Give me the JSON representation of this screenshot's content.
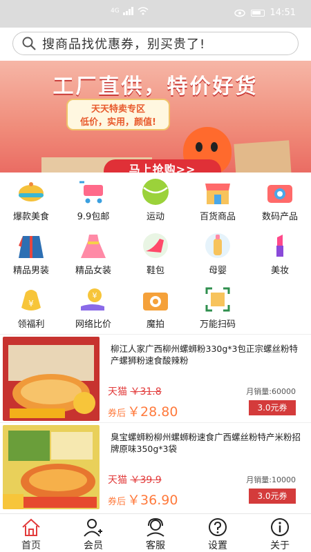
{
  "status_bar": {
    "time": "14:51",
    "network": "4G"
  },
  "search": {
    "placeholder": "搜商品找优惠券，别买贵了!"
  },
  "banner": {
    "title": "工厂直供，特价好货",
    "bubble_line1": "天天特卖专区",
    "bubble_line2": "低价，实用，颜值!",
    "button": "马上抢购>>"
  },
  "categories": [
    {
      "label": "爆款美食",
      "icon": "food-cloche-icon"
    },
    {
      "label": "9.9包邮",
      "icon": "shopping-cart-icon"
    },
    {
      "label": "运动",
      "icon": "tennis-ball-icon"
    },
    {
      "label": "百货商品",
      "icon": "store-icon"
    },
    {
      "label": "数码产品",
      "icon": "camera-icon"
    },
    {
      "label": "精品男装",
      "icon": "jacket-icon"
    },
    {
      "label": "精品女装",
      "icon": "dress-icon"
    },
    {
      "label": "鞋包",
      "icon": "high-heel-icon"
    },
    {
      "label": "母婴",
      "icon": "baby-bottle-icon"
    },
    {
      "label": "美妆",
      "icon": "lipstick-icon"
    },
    {
      "label": "领福利",
      "icon": "money-bag-icon"
    },
    {
      "label": "网络比价",
      "icon": "coin-hand-icon"
    },
    {
      "label": "魔拍",
      "icon": "camera-orange-icon"
    },
    {
      "label": "万能扫码",
      "icon": "scan-frame-icon"
    }
  ],
  "products": [
    {
      "title": "柳江人家广西柳州螺蛳粉330g*3包正宗螺丝粉特产螺狮粉速食酸辣粉",
      "platform": "天猫",
      "original_price": "￥31.8",
      "sales": "月销量:60000",
      "after_label": "券后",
      "price": "￥28.80",
      "coupon": "3.0元券"
    },
    {
      "title": "臭宝螺蛳粉柳州螺蛳粉速食广西螺丝粉特产米粉招牌原味350g*3袋",
      "platform": "天猫",
      "original_price": "￥39.9",
      "sales": "月销量:10000",
      "after_label": "券后",
      "price": "￥36.90",
      "coupon": "3.0元券"
    }
  ],
  "tabs": [
    {
      "label": "首页",
      "icon": "home-icon"
    },
    {
      "label": "会员",
      "icon": "member-icon"
    },
    {
      "label": "客服",
      "icon": "headset-icon"
    },
    {
      "label": "设置",
      "icon": "question-icon"
    },
    {
      "label": "关于",
      "icon": "info-icon"
    }
  ],
  "colors": {
    "accent": "#e23b3b",
    "price": "#ff7a3c",
    "coupon": "#d43b3b"
  }
}
